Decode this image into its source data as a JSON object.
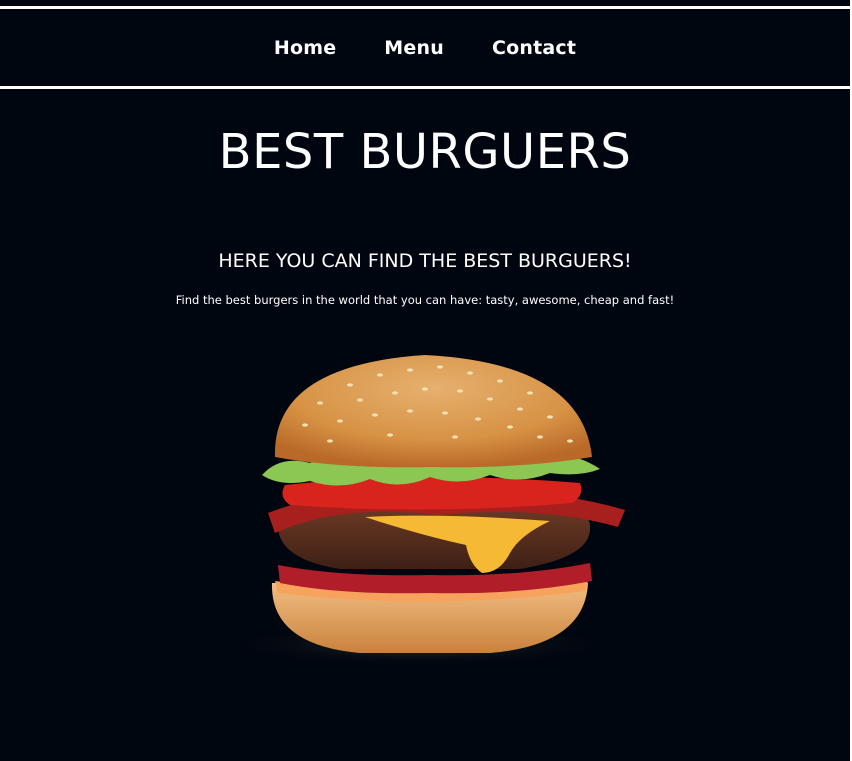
{
  "nav": {
    "items": [
      {
        "label": "Home"
      },
      {
        "label": "Menu"
      },
      {
        "label": "Contact"
      }
    ]
  },
  "hero": {
    "title": "BEST BURGUERS",
    "subtitle": "HERE YOU CAN FIND THE BEST BURGUERS!",
    "description": "Find the best burgers in the world that you can have: tasty, awesome, cheap and fast!"
  },
  "colors": {
    "background": "#000610",
    "text": "#ffffff",
    "bun": "#d9984f",
    "lettuce": "#8cc653",
    "tomato": "#d8241c",
    "cheese": "#f6b933",
    "patty": "#5a3122"
  },
  "image": {
    "subject": "burger-image"
  }
}
